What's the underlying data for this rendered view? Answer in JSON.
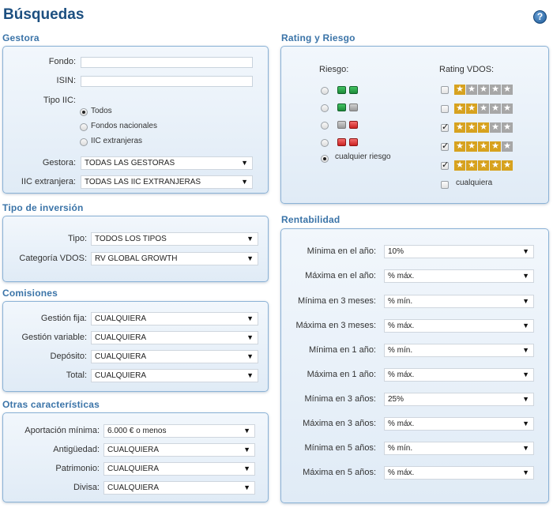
{
  "header": {
    "title": "Búsquedas",
    "help_label": "?"
  },
  "gestora": {
    "title": "Gestora",
    "fondo_label": "Fondo:",
    "fondo_value": "",
    "isin_label": "ISIN:",
    "isin_value": "",
    "tipo_iic_label": "Tipo IIC:",
    "tipo_options": [
      "Todos",
      "Fondos nacionales",
      "IIC extranjeras"
    ],
    "gestora_label": "Gestora:",
    "gestora_value": "TODAS LAS GESTORAS",
    "iic_ext_label": "IIC extranjera:",
    "iic_ext_value": "TODAS LAS IIC EXTRANJERAS"
  },
  "inversion": {
    "title": "Tipo de inversión",
    "tipo_label": "Tipo:",
    "tipo_value": "TODOS LOS TIPOS",
    "categoria_label": "Categoría VDOS:",
    "categoria_value": "RV GLOBAL GROWTH"
  },
  "comisiones": {
    "title": "Comisiones",
    "rows": [
      {
        "label": "Gestión fija:",
        "value": "CUALQUIERA"
      },
      {
        "label": "Gestión variable:",
        "value": "CUALQUIERA"
      },
      {
        "label": "Depósito:",
        "value": "CUALQUIERA"
      },
      {
        "label": "Total:",
        "value": "CUALQUIERA"
      }
    ]
  },
  "otras": {
    "title": "Otras características",
    "rows": [
      {
        "label": "Aportación mínima:",
        "value": "6.000 € o menos"
      },
      {
        "label": "Antigüedad:",
        "value": "CUALQUIERA"
      },
      {
        "label": "Patrimonio:",
        "value": "CUALQUIERA"
      },
      {
        "label": "Divisa:",
        "value": "CUALQUIERA"
      }
    ]
  },
  "rating_riesgo": {
    "title": "Rating y Riesgo",
    "riesgo_label": "Riesgo:",
    "riesgo_any_label": "cualquier riesgo",
    "rating_label": "Rating VDOS:",
    "rating_any_label": "cualquiera",
    "star_glyph": "★",
    "check_glyph": "✓",
    "rating_levels": [
      1,
      2,
      3,
      4,
      5
    ],
    "rating_checked": [
      false,
      false,
      true,
      true,
      true
    ],
    "riesgo_levels": [
      [
        "green",
        "green"
      ],
      [
        "green",
        "gray"
      ],
      [
        "gray",
        "red"
      ],
      [
        "red",
        "red"
      ]
    ],
    "riesgo_selected": "cualquier riesgo"
  },
  "rentabilidad": {
    "title": "Rentabilidad",
    "rows": [
      {
        "label": "Mínima en el año:",
        "value": "10%"
      },
      {
        "label": "Máxima en el año:",
        "value": "% máx."
      },
      {
        "label": "Mínima en 3 meses:",
        "value": "% mín."
      },
      {
        "label": "Máxima en 3 meses:",
        "value": "% máx."
      },
      {
        "label": "Mínima en 1 año:",
        "value": "% mín."
      },
      {
        "label": "Máxima en 1 año:",
        "value": "% máx."
      },
      {
        "label": "Mínima en 3 años:",
        "value": "25%"
      },
      {
        "label": "Máxima en 3 años:",
        "value": "% máx."
      },
      {
        "label": "Mínima en 5 años:",
        "value": "% mín."
      },
      {
        "label": "Máxima en 5 años:",
        "value": "% máx."
      }
    ]
  },
  "select_arrow": "▼"
}
